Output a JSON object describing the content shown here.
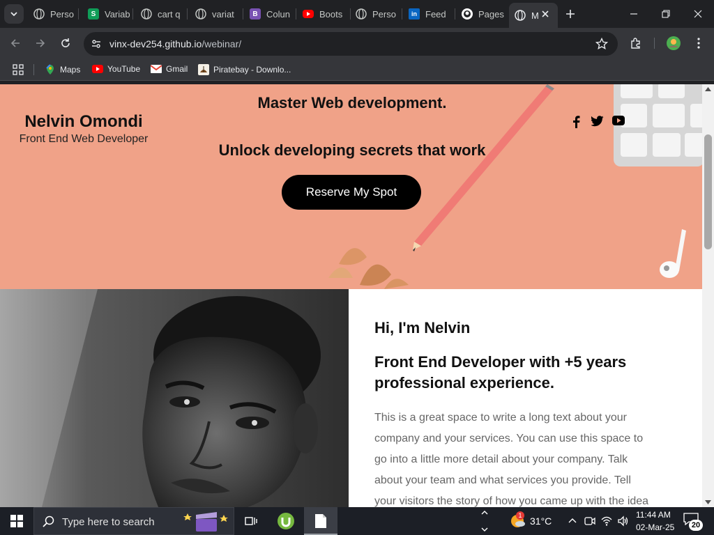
{
  "tabs": [
    {
      "title": "Perso",
      "icon": "globe-icon"
    },
    {
      "title": "Variab",
      "icon": "s-brand-icon"
    },
    {
      "title": "cart q",
      "icon": "globe-icon"
    },
    {
      "title": "variat",
      "icon": "globe-icon"
    },
    {
      "title": "Colun",
      "icon": "bootstrap-icon"
    },
    {
      "title": "Boots",
      "icon": "youtube-icon"
    },
    {
      "title": "Perso",
      "icon": "globe-icon"
    },
    {
      "title": "Feed",
      "icon": "linkedin-icon"
    },
    {
      "title": "Pages",
      "icon": "github-icon"
    },
    {
      "title": "M",
      "icon": "globe-icon"
    }
  ],
  "address_bar": {
    "host": "vinx-dev254.github.io",
    "path": "/webinar/"
  },
  "bookmarks": [
    {
      "label": "Maps",
      "icon": "maps-icon"
    },
    {
      "label": "YouTube",
      "icon": "youtube-icon"
    },
    {
      "label": "Gmail",
      "icon": "gmail-icon"
    },
    {
      "label": "Piratebay - Downlo...",
      "icon": "piratebay-icon"
    }
  ],
  "hero": {
    "name": "Nelvin Omondi",
    "role": "Front End Web Developer",
    "headline": "Master Web development.",
    "subheadline": "Unlock developing secrets that work",
    "cta_label": "Reserve My Spot",
    "social_icons": [
      "facebook-icon",
      "twitter-icon",
      "youtube-icon"
    ],
    "background_color": "#f0a288"
  },
  "about": {
    "greeting": "Hi, I'm Nelvin",
    "headline": "Front End Developer with +5 years professional experience.",
    "body": "This is a great space to write a long text about your company and your services. You can use this space to go into a little more detail about your company. Talk about your team and what services you provide. Tell your visitors the story of how you came up with the idea"
  },
  "taskbar": {
    "search_placeholder": "Type here to search",
    "temperature": "31°C",
    "time": "11:44 AM",
    "date": "02-Mar-25",
    "notification_count": "20",
    "weather_badge": "1"
  }
}
